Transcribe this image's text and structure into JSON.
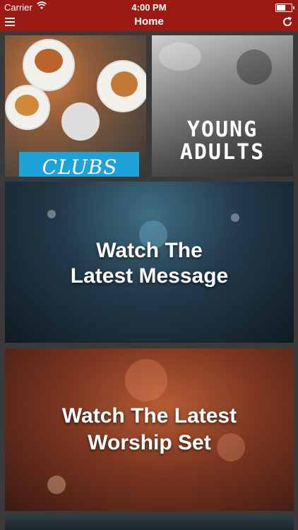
{
  "status_bar": {
    "carrier": "Carrier",
    "time": "4:00 PM",
    "battery_level": 0.6
  },
  "nav": {
    "title": "Home",
    "menu_icon": "hamburger-menu-icon",
    "refresh_icon": "refresh-icon"
  },
  "tiles": {
    "clubs": {
      "label": "CLUBS"
    },
    "young_adults": {
      "line1": "YOUNG",
      "line2": "ADULTS"
    },
    "message": {
      "line1": "Watch The",
      "line2": "Latest Message"
    },
    "worship": {
      "line1": "Watch The Latest",
      "line2": "Worship Set"
    }
  },
  "colors": {
    "brand_red": "#9b1b14",
    "clubs_blue": "#1ea2d8",
    "background": "#3a3a3a"
  }
}
